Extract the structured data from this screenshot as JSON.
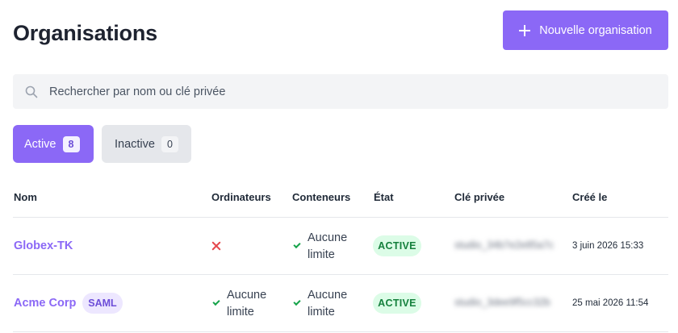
{
  "page": {
    "title": "Organisations",
    "new_button_label": "Nouvelle organisation"
  },
  "search": {
    "placeholder": "Rechercher par nom ou clé privée",
    "value": ""
  },
  "tabs": [
    {
      "label": "Active",
      "count": "8",
      "selected": true
    },
    {
      "label": "Inactive",
      "count": "0",
      "selected": false
    }
  ],
  "table": {
    "columns": [
      "Nom",
      "Ordinateurs",
      "Conteneurs",
      "État",
      "Clé privée",
      "Créé le"
    ],
    "rows": [
      {
        "name": "Globex-TK",
        "badge": "",
        "computers": {
          "allowed": false,
          "text": ""
        },
        "containers": {
          "allowed": true,
          "text": "Aucune limite"
        },
        "status": "ACTIVE",
        "private_key": "studio_34b7e2e85a7c",
        "created": "3 juin 2026 15:33"
      },
      {
        "name": "Acme Corp",
        "badge": "SAML",
        "computers": {
          "allowed": true,
          "text": "Aucune limite"
        },
        "containers": {
          "allowed": true,
          "text": "Aucune limite"
        },
        "status": "ACTIVE",
        "private_key": "studio_3dee9f5cc32b",
        "created": "25 mai 2026 11:54"
      }
    ]
  },
  "colors": {
    "accent": "#8b68f6",
    "status_active_bg": "#dcfce7",
    "status_active_text": "#15803d",
    "error": "#e5484d",
    "success": "#16a34a"
  }
}
